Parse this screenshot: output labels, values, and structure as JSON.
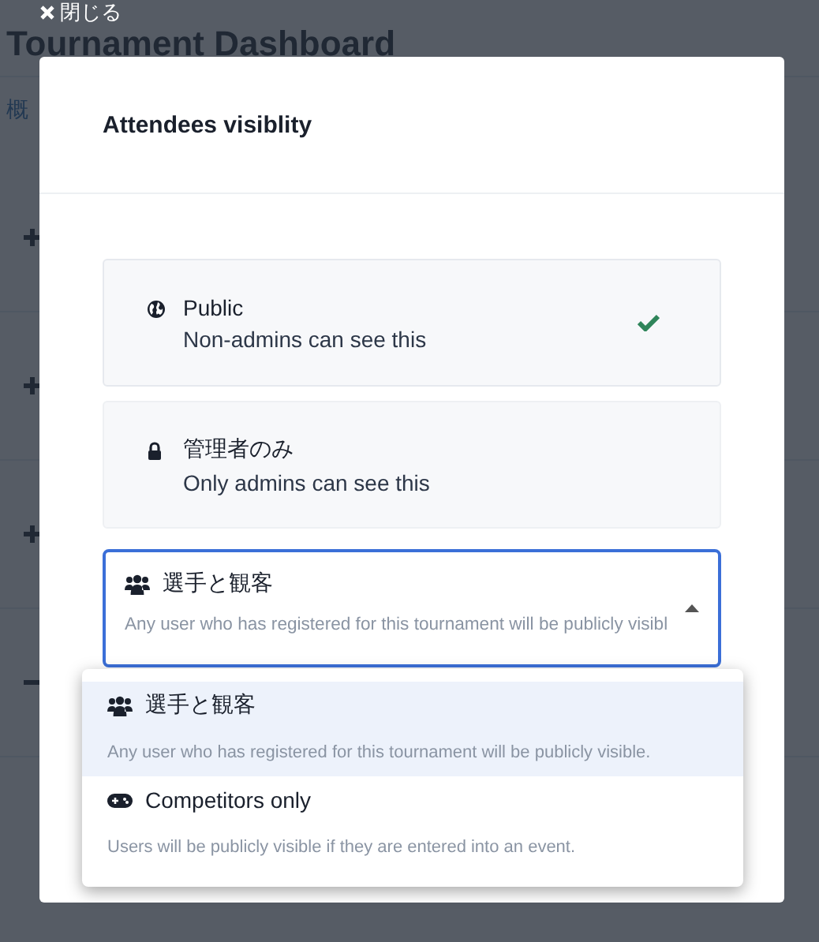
{
  "background_page": {
    "title": "Tournament Dashboard",
    "nav_link": "概",
    "rows": [
      {
        "expanded": false
      },
      {
        "expanded": false
      },
      {
        "expanded": false
      },
      {
        "expanded": true
      }
    ]
  },
  "close_button": {
    "label": "閉じる"
  },
  "modal": {
    "title": "Attendees visiblity",
    "options": [
      {
        "kind": "public",
        "title": "Public",
        "description": "Non-admins can see this",
        "selected": true
      },
      {
        "kind": "admins",
        "title": "管理者のみ",
        "description": "Only admins can see this",
        "selected": false
      }
    ],
    "select": {
      "kind": "attendees",
      "value": "選手と観客",
      "description": "Any user who has registered for this tournament will be publicly visibl",
      "expanded": true,
      "items": [
        {
          "kind": "attendees",
          "title": "選手と観客",
          "description": "Any user who has registered for this tournament will be publicly visible.",
          "selected": true
        },
        {
          "kind": "competitors",
          "title": "Competitors only",
          "description": "Users will be publicly visible if they are entered into an event.",
          "selected": false
        }
      ]
    }
  }
}
